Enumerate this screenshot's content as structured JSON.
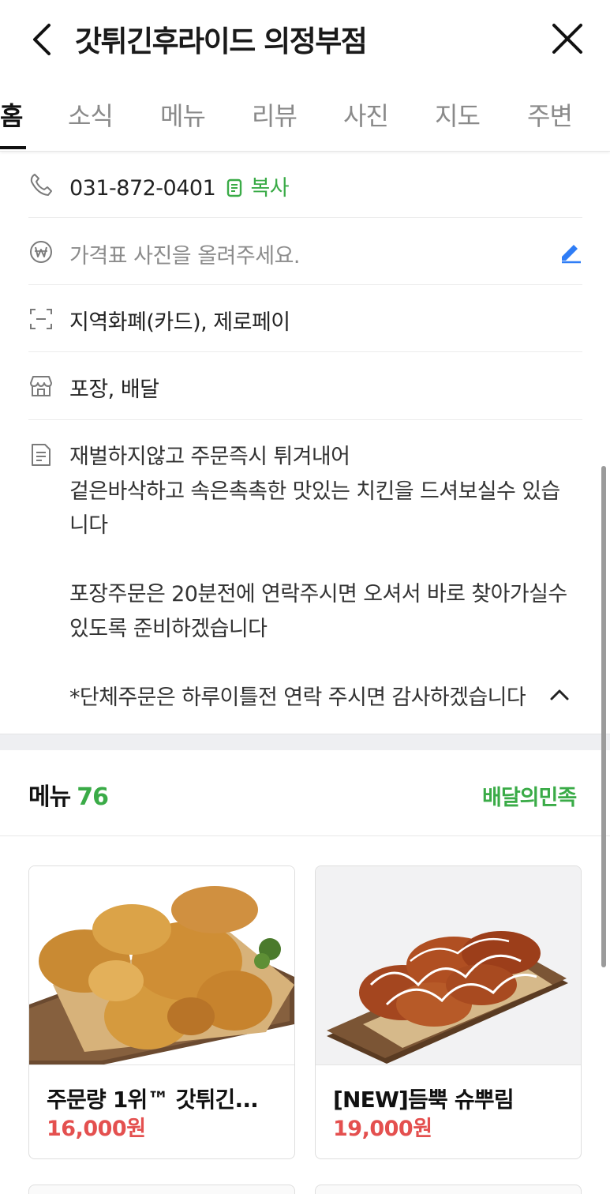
{
  "header": {
    "title": "갓튀긴후라이드 의정부점"
  },
  "tabs": [
    {
      "label": "홈",
      "active": true
    },
    {
      "label": "소식"
    },
    {
      "label": "메뉴"
    },
    {
      "label": "리뷰"
    },
    {
      "label": "사진"
    },
    {
      "label": "지도"
    },
    {
      "label": "주변"
    }
  ],
  "info": {
    "phone": "031-872-0401",
    "copy_label": "복사",
    "price_prompt": "가격표 사진을 올려주세요.",
    "payment": "지역화폐(카드), 제로페이",
    "service": "포장, 배달",
    "description": [
      "재벌하지않고 주문즉시 튀겨내어",
      "겉은바삭하고 속은촉촉한 맛있는 치킨을 드셔보실수 있습",
      "니다",
      "",
      "포장주문은 20분전에 연락주시면 오셔서 바로 찾아가실수",
      "있도록 준비하겠습니다",
      "",
      "*단체주문은 하루이틀전 연락 주시면 감사하겠습니다"
    ]
  },
  "menu": {
    "heading": "메뉴",
    "count": "76",
    "source": "배달의민족",
    "items": [
      {
        "name": "주문량 1위™ 갓튀긴...",
        "price": "16,000원"
      },
      {
        "name": "[NEW]듬뿍 슈뿌림",
        "price": "19,000원"
      }
    ]
  },
  "colors": {
    "accent": "#3aab47",
    "price": "#e4504f",
    "edit": "#2f7df6"
  }
}
